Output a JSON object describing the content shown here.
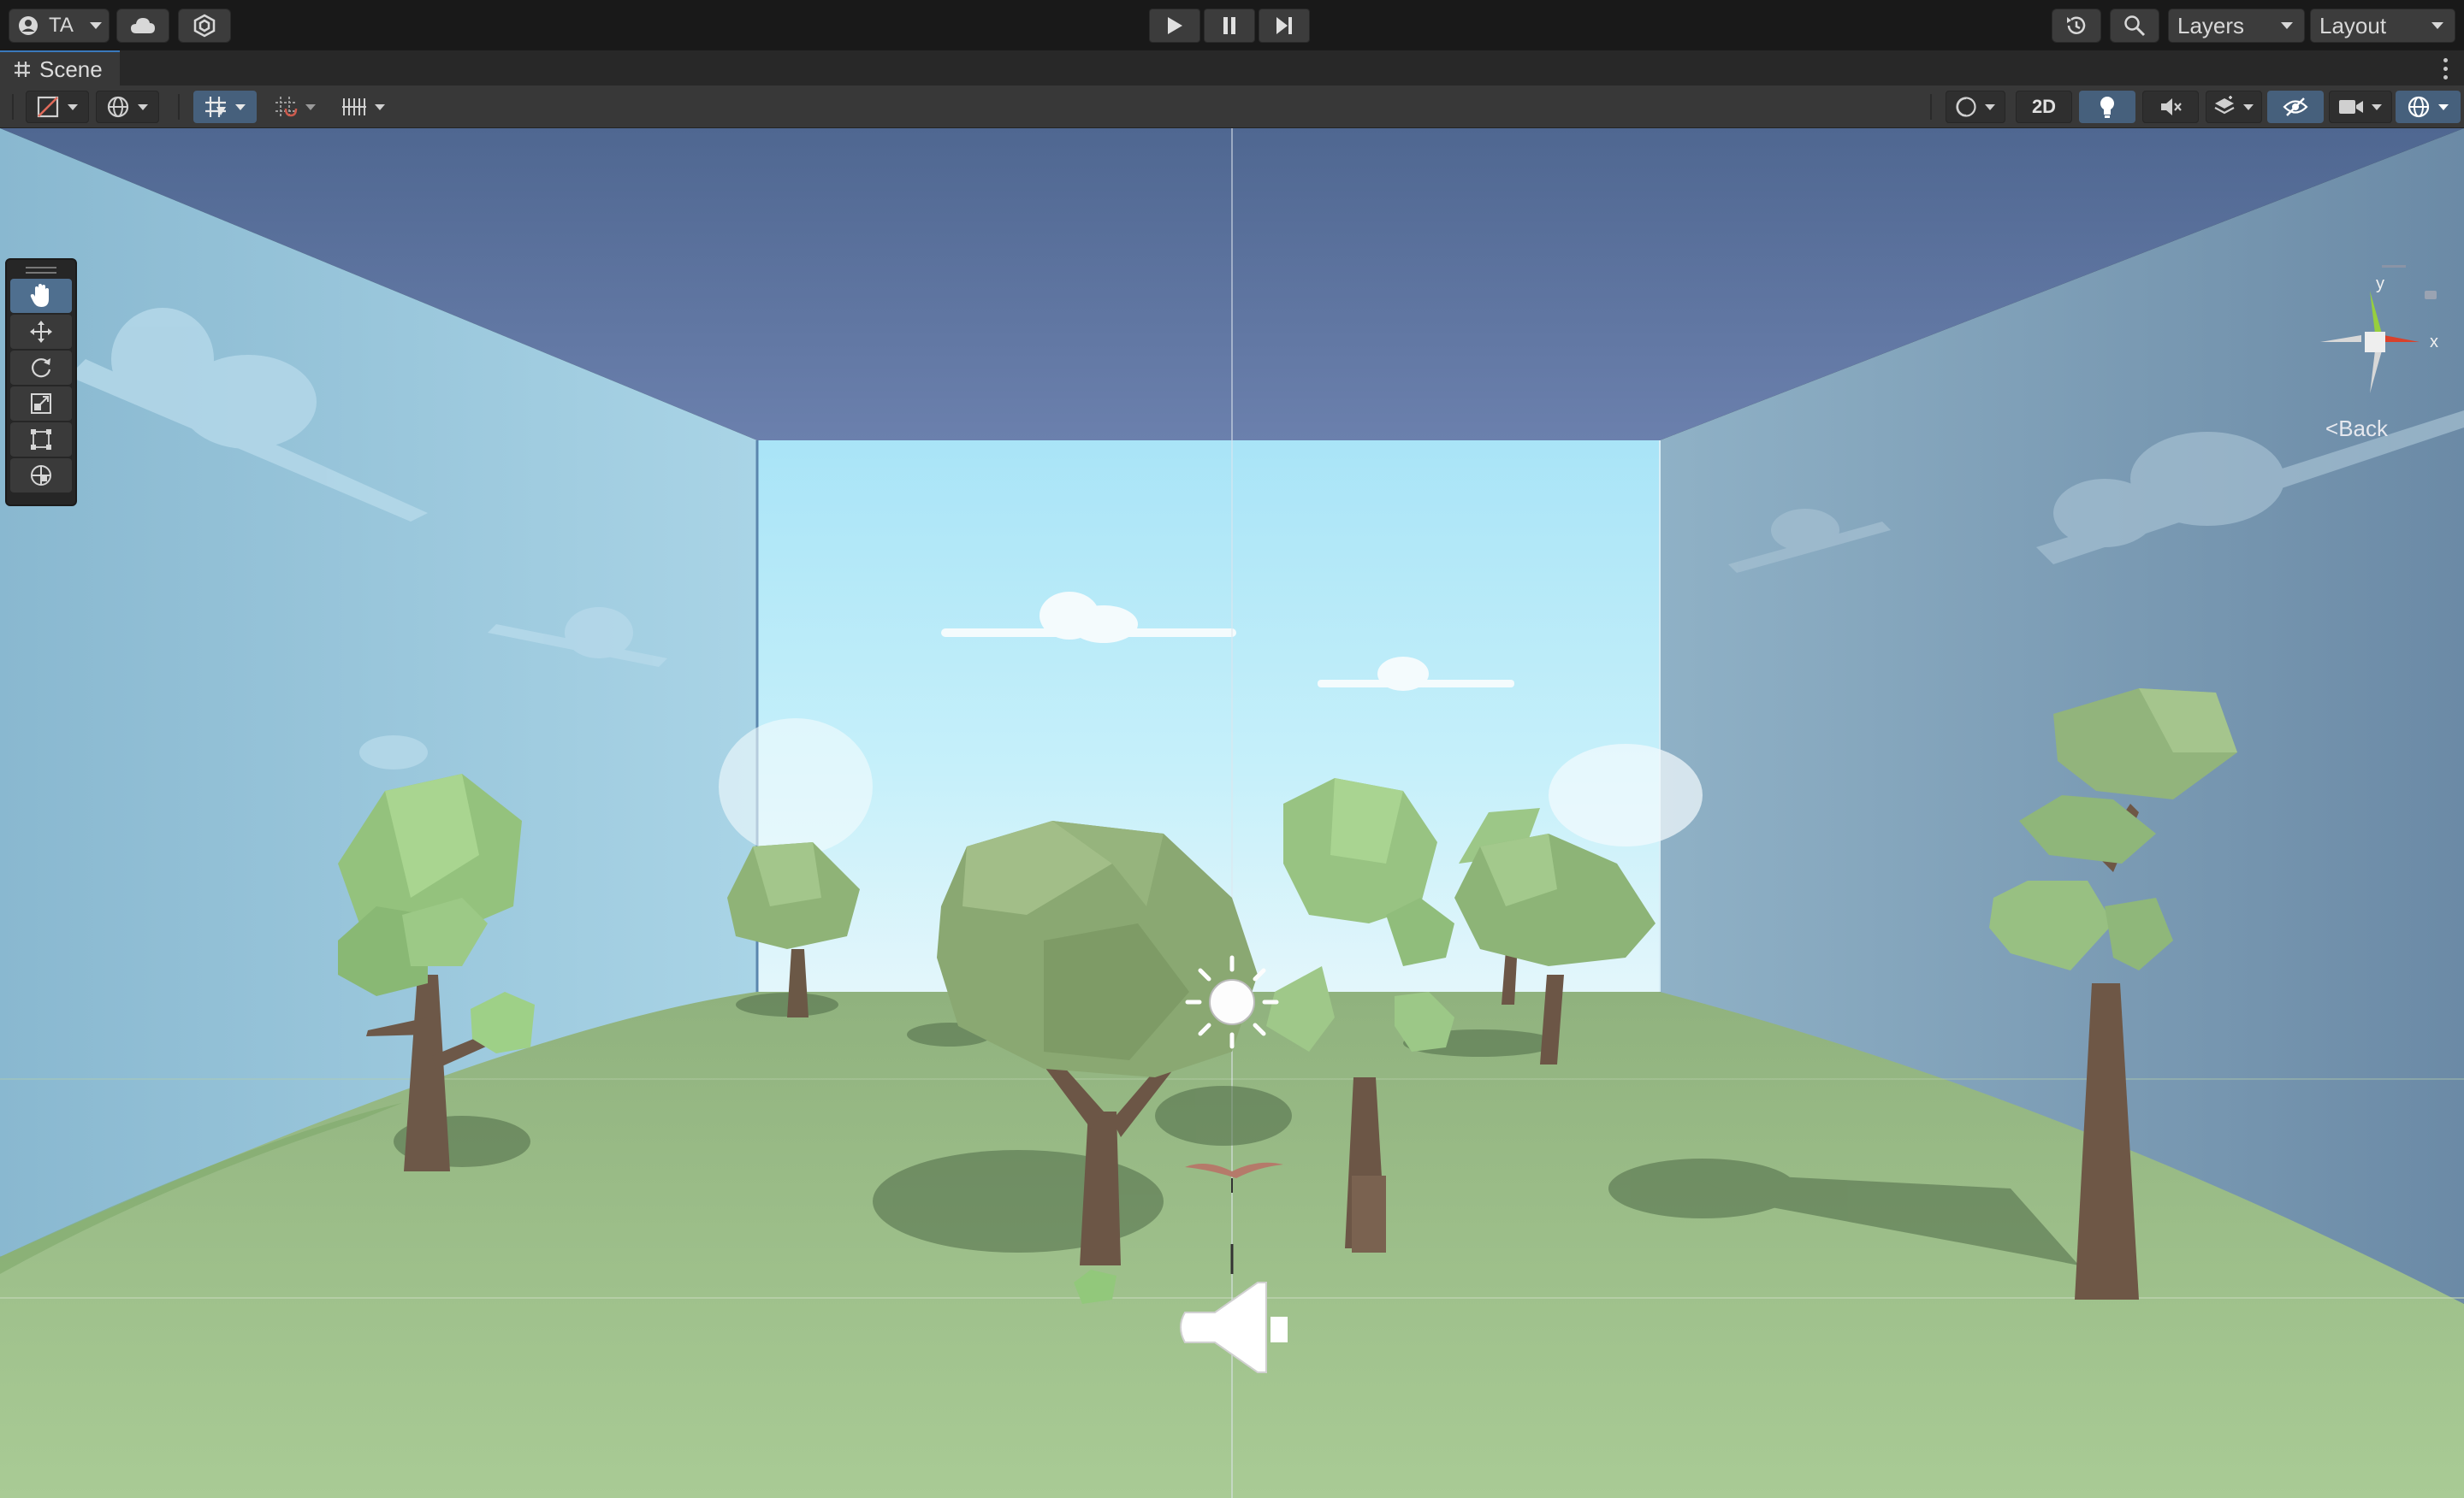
{
  "topbar": {
    "account_label": "TA",
    "layers_label": "Layers",
    "layout_label": "Layout"
  },
  "tab": {
    "scene_label": "Scene"
  },
  "scene_toolbar": {
    "mode_2d_label": "2D"
  },
  "gizmo": {
    "y_label": "y",
    "x_label": "x",
    "back_label": "Back"
  },
  "colors": {
    "accent_blue": "#46607c",
    "toolbar_bg": "#191919",
    "panel_bg": "#383838",
    "gizmo_x": "#d9412b",
    "gizmo_y": "#97cf3e"
  }
}
